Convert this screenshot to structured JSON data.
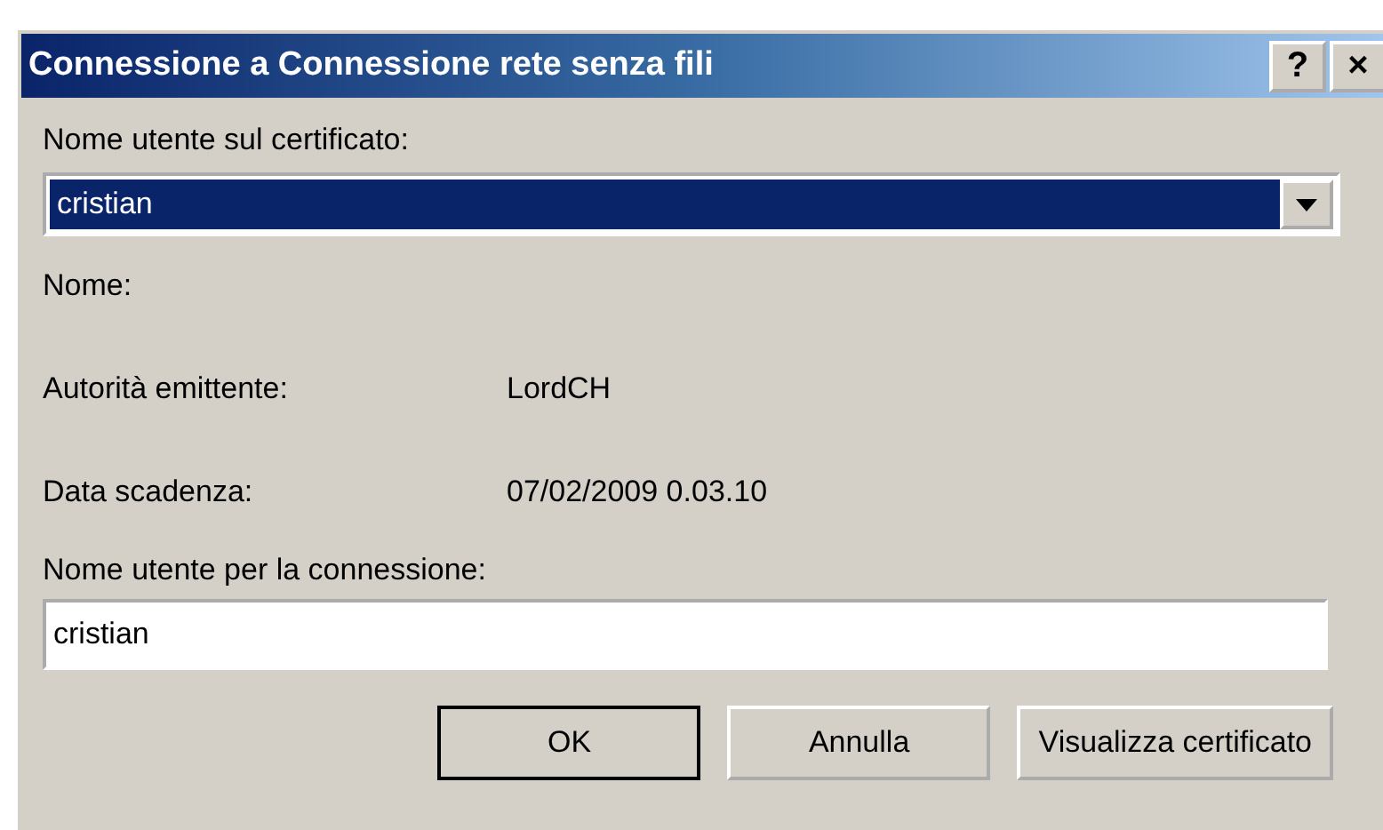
{
  "window": {
    "title": "Connessione a Connessione rete senza fili",
    "title_buttons": [
      "?",
      "×"
    ]
  },
  "certificate_user": {
    "label": "Nome utente sul certificato:",
    "value": "cristian"
  },
  "details": [
    {
      "label": "Nome:"
    },
    {
      "label": "Autorità emittente:",
      "value": "LordCH"
    },
    {
      "label": "Data scadenza:",
      "value": "07/02/2009 0.03.10"
    }
  ],
  "connection_user": {
    "label": "Nome utente per la connessione:",
    "value": "cristian"
  },
  "buttons": [
    {
      "label": "OK",
      "default": true
    },
    {
      "label": "Annulla",
      "default": false
    },
    {
      "label": "Visualizza certificato",
      "default": false
    }
  ]
}
